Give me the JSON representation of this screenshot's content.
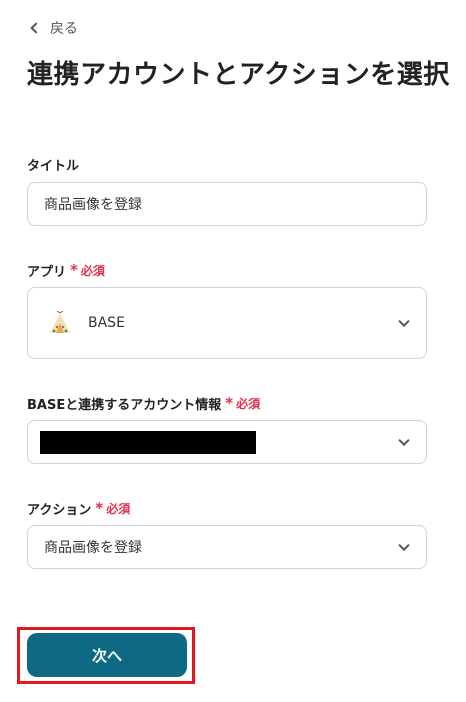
{
  "header": {
    "back_label": "戻る",
    "title": "連携アカウントとアクションを選択"
  },
  "form": {
    "title_field": {
      "label": "タイトル",
      "value": "商品画像を登録"
    },
    "app_field": {
      "label": "アプリ",
      "required_mark": "*",
      "required_label": "必須",
      "value": "BASE",
      "icon": "base-teepee-icon"
    },
    "account_field": {
      "label": "BASEと連携するアカウント情報",
      "required_mark": "*",
      "required_label": "必須",
      "value": ""
    },
    "action_field": {
      "label": "アクション",
      "required_mark": "*",
      "required_label": "必須",
      "value": "商品画像を登録"
    }
  },
  "footer": {
    "next_label": "次へ"
  },
  "colors": {
    "primary": "#0d6a82",
    "required": "#e2314d",
    "highlight": "#e0181e"
  }
}
